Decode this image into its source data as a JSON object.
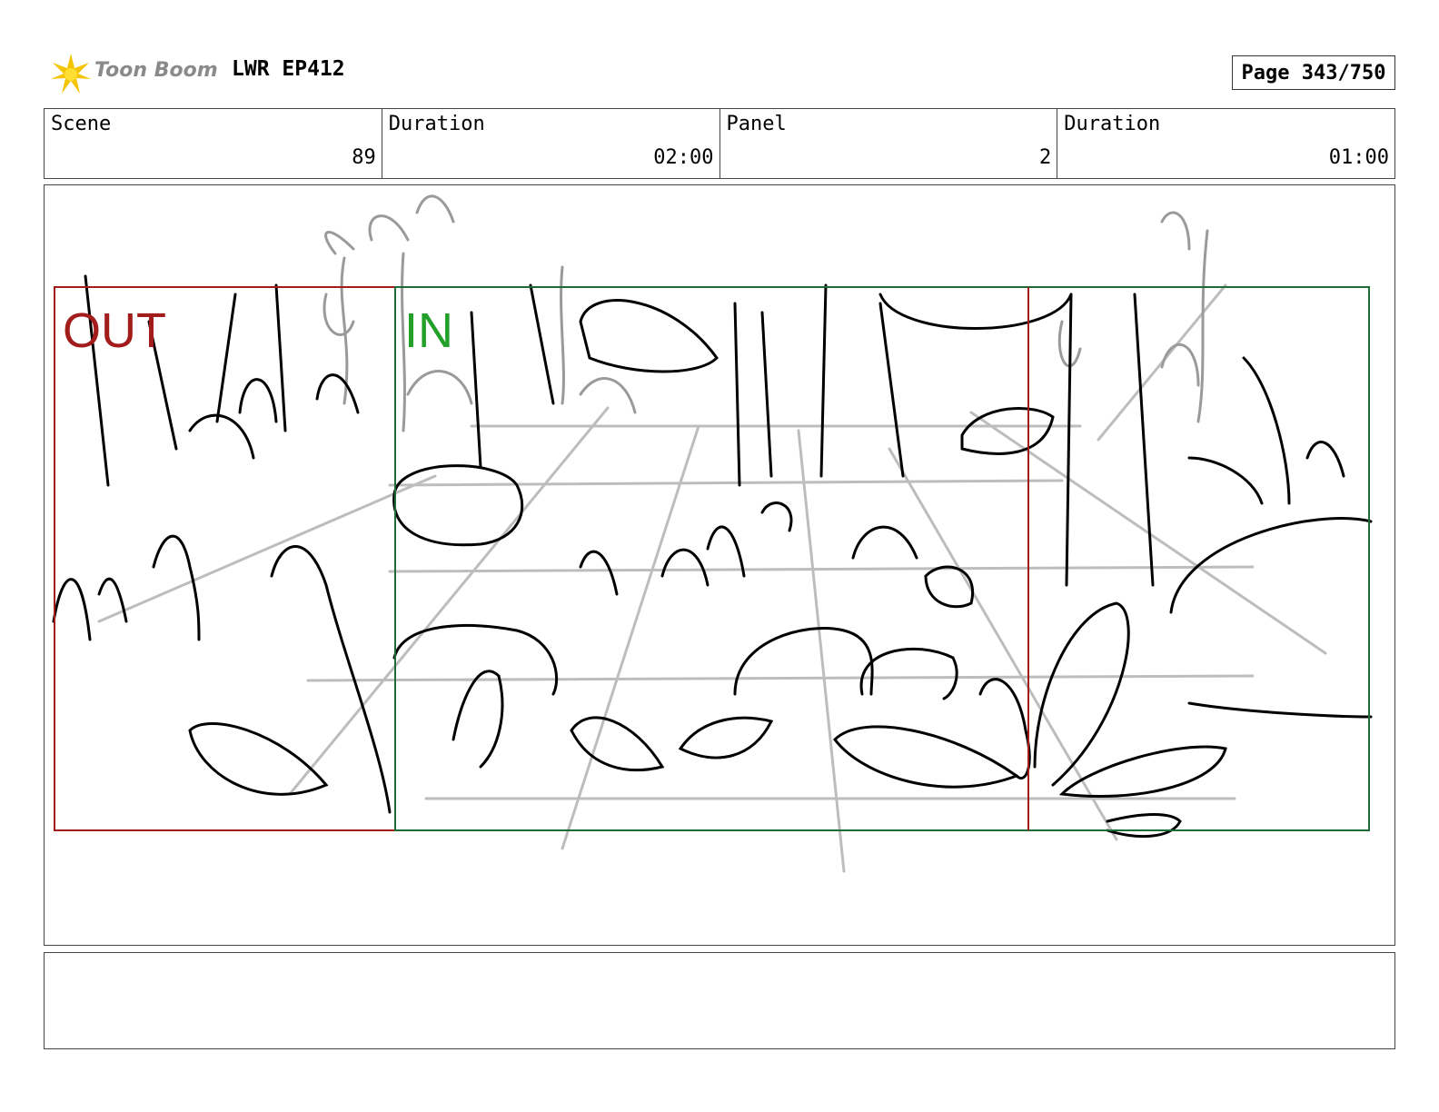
{
  "header": {
    "logo_text": "Toon Boom",
    "project": "LWR EP412",
    "page": "Page 343/750"
  },
  "info": {
    "scene_label": "Scene",
    "scene_value": "89",
    "scene_duration_label": "Duration",
    "scene_duration_value": "02:00",
    "panel_label": "Panel",
    "panel_value": "2",
    "panel_duration_label": "Duration",
    "panel_duration_value": "01:00"
  },
  "frames": {
    "out_label": "OUT",
    "in_label": "IN",
    "out_color": "#a31c1c",
    "in_color": "#1e6b35",
    "in_text_color": "#22a02a"
  },
  "notes": {
    "text": ""
  }
}
